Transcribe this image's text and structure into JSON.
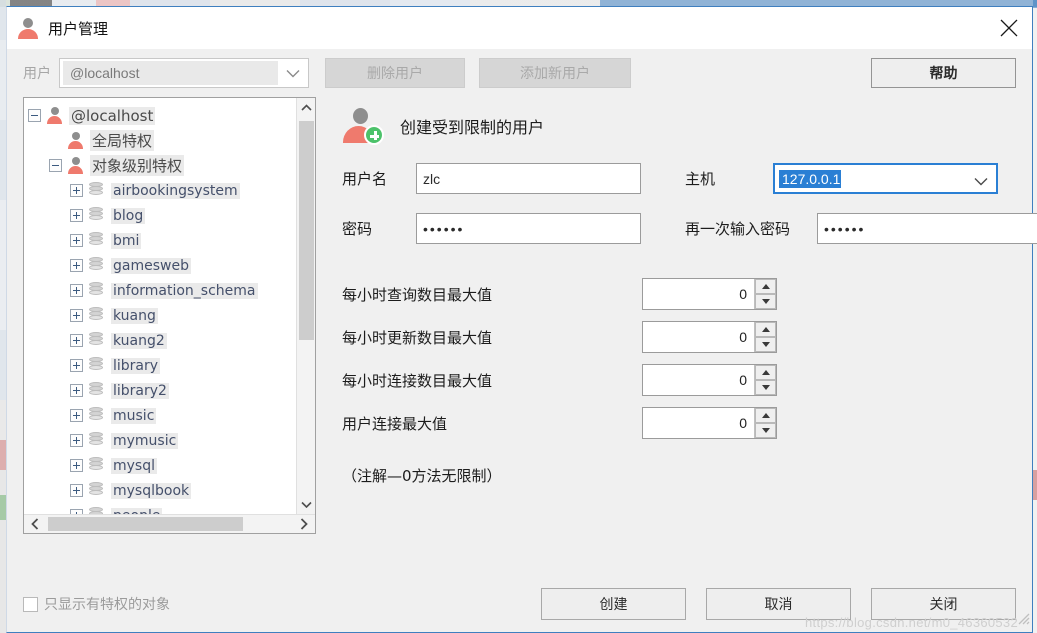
{
  "window": {
    "title": "用户管理",
    "title_icon": "user-icon",
    "close_icon": "close-icon"
  },
  "toolbar": {
    "user_label": "用户",
    "user_combo_value": "@localhost",
    "delete_user_label": "删除用户",
    "add_user_label": "添加新用户",
    "help_label": "帮助"
  },
  "tree": {
    "nodes": [
      {
        "label": "@localhost",
        "indent": 0,
        "state": "expanded",
        "icon": "user-icon",
        "type": "cn"
      },
      {
        "label": "全局特权",
        "indent": 1,
        "state": "leaf",
        "icon": "users-icon",
        "type": "cn"
      },
      {
        "label": "对象级别特权",
        "indent": 1,
        "state": "expanded",
        "icon": "user-icon",
        "type": "cn"
      },
      {
        "label": "airbookingsystem",
        "indent": 2,
        "state": "collapsed",
        "icon": "database-icon",
        "type": "db"
      },
      {
        "label": "blog",
        "indent": 2,
        "state": "collapsed",
        "icon": "database-icon",
        "type": "db"
      },
      {
        "label": "bmi",
        "indent": 2,
        "state": "collapsed",
        "icon": "database-icon",
        "type": "db"
      },
      {
        "label": "gamesweb",
        "indent": 2,
        "state": "collapsed",
        "icon": "database-icon",
        "type": "db"
      },
      {
        "label": "information_schema",
        "indent": 2,
        "state": "collapsed",
        "icon": "database-icon",
        "type": "db"
      },
      {
        "label": "kuang",
        "indent": 2,
        "state": "collapsed",
        "icon": "database-icon",
        "type": "db"
      },
      {
        "label": "kuang2",
        "indent": 2,
        "state": "collapsed",
        "icon": "database-icon",
        "type": "db"
      },
      {
        "label": "library",
        "indent": 2,
        "state": "collapsed",
        "icon": "database-icon",
        "type": "db"
      },
      {
        "label": "library2",
        "indent": 2,
        "state": "collapsed",
        "icon": "database-icon",
        "type": "db"
      },
      {
        "label": "music",
        "indent": 2,
        "state": "collapsed",
        "icon": "database-icon",
        "type": "db"
      },
      {
        "label": "mymusic",
        "indent": 2,
        "state": "collapsed",
        "icon": "database-icon",
        "type": "db"
      },
      {
        "label": "mysql",
        "indent": 2,
        "state": "collapsed",
        "icon": "database-icon",
        "type": "db"
      },
      {
        "label": "mysqlbook",
        "indent": 2,
        "state": "collapsed",
        "icon": "database-icon",
        "type": "db"
      },
      {
        "label": "people",
        "indent": 2,
        "state": "collapsed",
        "icon": "database-icon",
        "type": "db"
      }
    ]
  },
  "form": {
    "heading": "创建受到限制的用户",
    "heading_icon": "add-user-icon",
    "username_label": "用户名",
    "username_value": "zlc",
    "host_label": "主机",
    "host_value": "127.0.0.1",
    "password_label": "密码",
    "password_value": "••••••",
    "password2_label": "再一次输入密码",
    "password2_value": "••••••",
    "limits": [
      {
        "label": "每小时查询数目最大值",
        "value": "0"
      },
      {
        "label": "每小时更新数目最大值",
        "value": "0"
      },
      {
        "label": "每小时连接数目最大值",
        "value": "0"
      },
      {
        "label": "用户连接最大值",
        "value": "0"
      }
    ],
    "note": "（注解—0方法无限制）"
  },
  "footer": {
    "checkbox_label": "只显示有特权的对象",
    "checkbox_checked": false,
    "create_label": "创建",
    "cancel_label": "取消",
    "close_label": "关闭"
  },
  "watermark": "https://blog.csdn.net/m0_46360532",
  "colors": {
    "accent_blue": "#2a7fd4",
    "window_bg": "#f0f0f0",
    "person_red": "#ef7a6d",
    "plus_green": "#4cc26a"
  }
}
